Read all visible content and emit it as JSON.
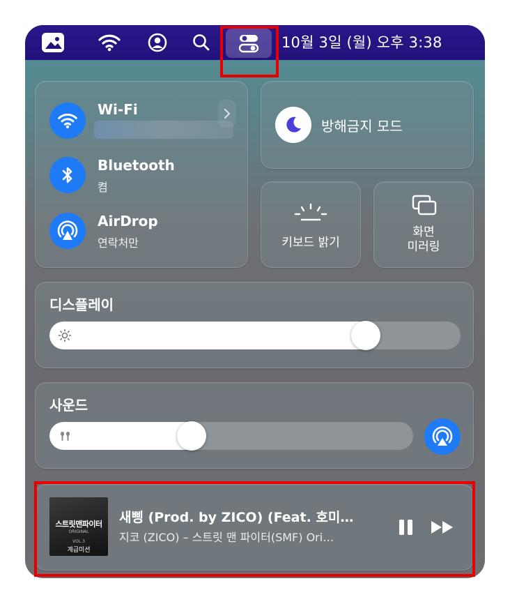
{
  "menubar": {
    "clock": "10월 3일 (월) 오후  3:38",
    "icons": [
      "photos-icon",
      "wifi-icon",
      "user-icon",
      "search-icon",
      "control-center-icon"
    ]
  },
  "connectivity": {
    "wifi_label": "Wi-Fi",
    "bluetooth_label": "Bluetooth",
    "bluetooth_status": "켬",
    "airdrop_label": "AirDrop",
    "airdrop_status": "연락처만"
  },
  "focus": {
    "label": "방해금지 모드"
  },
  "keyboard": {
    "label": "키보드 밝기"
  },
  "mirroring": {
    "line1": "화면",
    "line2": "미러링"
  },
  "display": {
    "title": "디스플레이",
    "brightness": 0.77
  },
  "sound": {
    "title": "사운드",
    "volume": 0.39
  },
  "now_playing": {
    "title": "새삥 (Prod. by ZICO) (Feat. 호미…",
    "artist": "지코 (ZICO) – 스트릿 맨 파이터(SMF) Ori…",
    "art_title": "스트릿맨파이터",
    "art_sub": "ORIGINAL",
    "art_vol": "VOL.3",
    "art_mission": "계급미션"
  },
  "colors": {
    "accent": "#1f7bf5",
    "menubar": "#22117a",
    "highlight": "#e60000"
  }
}
